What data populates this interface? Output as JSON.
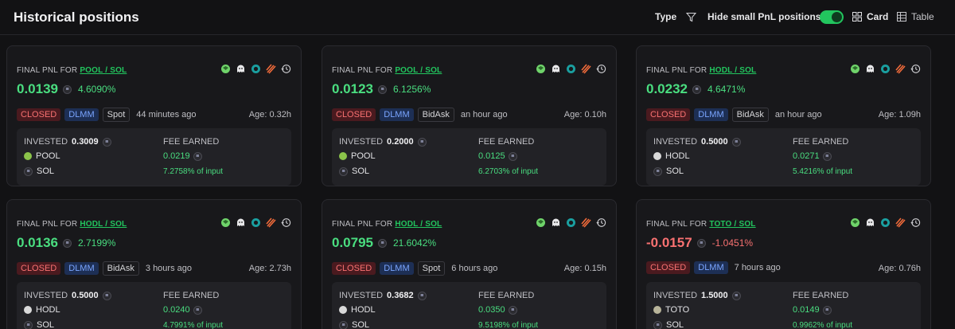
{
  "header": {
    "title": "Historical positions",
    "type_label": "Type",
    "hide_small_label": "Hide small PnL positions",
    "hide_small_enabled": true,
    "view_card_label": "Card",
    "view_table_label": "Table",
    "active_view": "Card"
  },
  "colors": {
    "positive": "#4ade80",
    "negative": "#f87171",
    "accent": "#22c55e",
    "dlmm": "#7aa5ff"
  },
  "card_label_prefix": "FINAL PNL FOR",
  "invested_label": "INVESTED",
  "fee_label": "FEE EARNED",
  "cards": [
    {
      "pair": "POOL / SOL",
      "pnl": "0.0139",
      "pnl_pct": "4.6090%",
      "status": "CLOSED",
      "protocol": "DLMM",
      "strategy": "Spot",
      "ago": "44 minutes ago",
      "age": "Age: 0.32h",
      "invested": "0.3009",
      "token": "POOL",
      "quote": "SOL",
      "fee": "0.0219",
      "fee_pct": "7.2758% of input",
      "negative": false
    },
    {
      "pair": "POOL / SOL",
      "pnl": "0.0123",
      "pnl_pct": "6.1256%",
      "status": "CLOSED",
      "protocol": "DLMM",
      "strategy": "BidAsk",
      "ago": "an hour ago",
      "age": "Age: 0.10h",
      "invested": "0.2000",
      "token": "POOL",
      "quote": "SOL",
      "fee": "0.0125",
      "fee_pct": "6.2703% of input",
      "negative": false
    },
    {
      "pair": "HODL / SOL",
      "pnl": "0.0232",
      "pnl_pct": "4.6471%",
      "status": "CLOSED",
      "protocol": "DLMM",
      "strategy": "BidAsk",
      "ago": "an hour ago",
      "age": "Age: 1.09h",
      "invested": "0.5000",
      "token": "HODL",
      "quote": "SOL",
      "fee": "0.0271",
      "fee_pct": "5.4216% of input",
      "negative": false
    },
    {
      "pair": "HODL / SOL",
      "pnl": "0.0136",
      "pnl_pct": "2.7199%",
      "status": "CLOSED",
      "protocol": "DLMM",
      "strategy": "BidAsk",
      "ago": "3 hours ago",
      "age": "Age: 2.73h",
      "invested": "0.5000",
      "token": "HODL",
      "quote": "SOL",
      "fee": "0.0240",
      "fee_pct": "4.7991% of input",
      "negative": false
    },
    {
      "pair": "HODL / SOL",
      "pnl": "0.0795",
      "pnl_pct": "21.6042%",
      "status": "CLOSED",
      "protocol": "DLMM",
      "strategy": "Spot",
      "ago": "6 hours ago",
      "age": "Age: 0.15h",
      "invested": "0.3682",
      "token": "HODL",
      "quote": "SOL",
      "fee": "0.0350",
      "fee_pct": "9.5198% of input",
      "negative": false
    },
    {
      "pair": "TOTO / SOL",
      "pnl": "-0.0157",
      "pnl_pct": "-1.0451%",
      "status": "CLOSED",
      "protocol": "DLMM",
      "strategy": "",
      "ago": "7 hours ago",
      "age": "Age: 0.76h",
      "invested": "1.5000",
      "token": "TOTO",
      "quote": "SOL",
      "fee": "0.0149",
      "fee_pct": "0.9962% of input",
      "negative": true
    }
  ]
}
